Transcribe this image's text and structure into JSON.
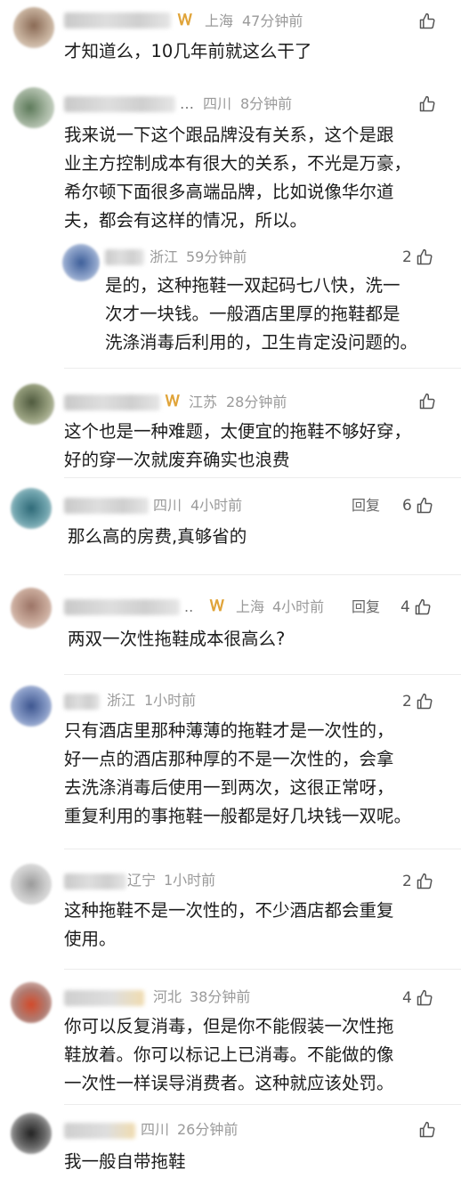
{
  "comments": [
    {
      "location": "上海",
      "time": "47分钟前",
      "badge": true,
      "likes": "",
      "reply": "",
      "lines": [
        "才知道么，10几年前就这么干了"
      ]
    },
    {
      "location": "四川",
      "time": "8分钟前",
      "badge": false,
      "ellipsis": "…",
      "likes": "",
      "reply": "",
      "lines": [
        "我来说一下这个跟品牌没有关系，这个是跟",
        "业主方控制成本有很大的关系，不光是万豪，",
        "希尔顿下面很多高端品牌，比如说像华尔道",
        "夫，都会有这样的情况，所以。"
      ]
    },
    {
      "location": "浙江",
      "time": "59分钟前",
      "badge": false,
      "likes": "2",
      "reply": "",
      "lines": [
        "是的，这种拖鞋一双起码七八快，洗一",
        "次才一块钱。一般酒店里厚的拖鞋都是",
        "洗涤消毒后利用的，卫生肯定没问题的。"
      ]
    },
    {
      "location": "江苏",
      "time": "28分钟前",
      "badge": true,
      "likes": "",
      "reply": "",
      "lines": [
        "这个也是一种难题，太便宜的拖鞋不够好穿，",
        "好的穿一次就废弃确实也浪费"
      ]
    },
    {
      "location": "四川",
      "time": "4小时前",
      "badge": false,
      "likes": "6",
      "reply": "回复",
      "lines": [
        "那么高的房费,真够省的"
      ]
    },
    {
      "location": "上海",
      "time": "4小时前",
      "badge": true,
      "ellipsis": "..",
      "likes": "4",
      "reply": "回复",
      "lines": [
        "两双一次性拖鞋成本很高么?"
      ]
    },
    {
      "location": "浙江",
      "time": "1小时前",
      "badge": false,
      "likes": "2",
      "reply": "",
      "lines": [
        "只有酒店里那种薄薄的拖鞋才是一次性的，",
        "好一点的酒店那种厚的不是一次性的，会拿",
        "去洗涤消毒后使用一到两次，这很正常呀，",
        "重复利用的事拖鞋一般都是好几块钱一双呢。"
      ]
    },
    {
      "location": "辽宁",
      "time": "1小时前",
      "badge": false,
      "likes": "2",
      "reply": "",
      "lines": [
        "这种拖鞋不是一次性的，不少酒店都会重复",
        "使用。"
      ]
    },
    {
      "location": "河北",
      "time": "38分钟前",
      "badge": false,
      "likes": "4",
      "reply": "",
      "lines": [
        "你可以反复消毒，但是你不能假装一次性拖",
        "鞋放着。你可以标记上已消毒。不能做的像",
        "一次性一样误导消费者。这种就应该处罚。"
      ]
    },
    {
      "location": "四川",
      "time": "26分钟前",
      "badge": false,
      "likes": "",
      "reply": "",
      "lines": [
        "我一般自带拖鞋"
      ]
    }
  ],
  "icons": {
    "like": "thumbs-up-icon",
    "badge": "vip-badge-icon"
  },
  "colors": {
    "meta": "#9a9a9a",
    "badge": "#e0a43a",
    "text": "#1c1c1c",
    "divider": "#ececec"
  }
}
